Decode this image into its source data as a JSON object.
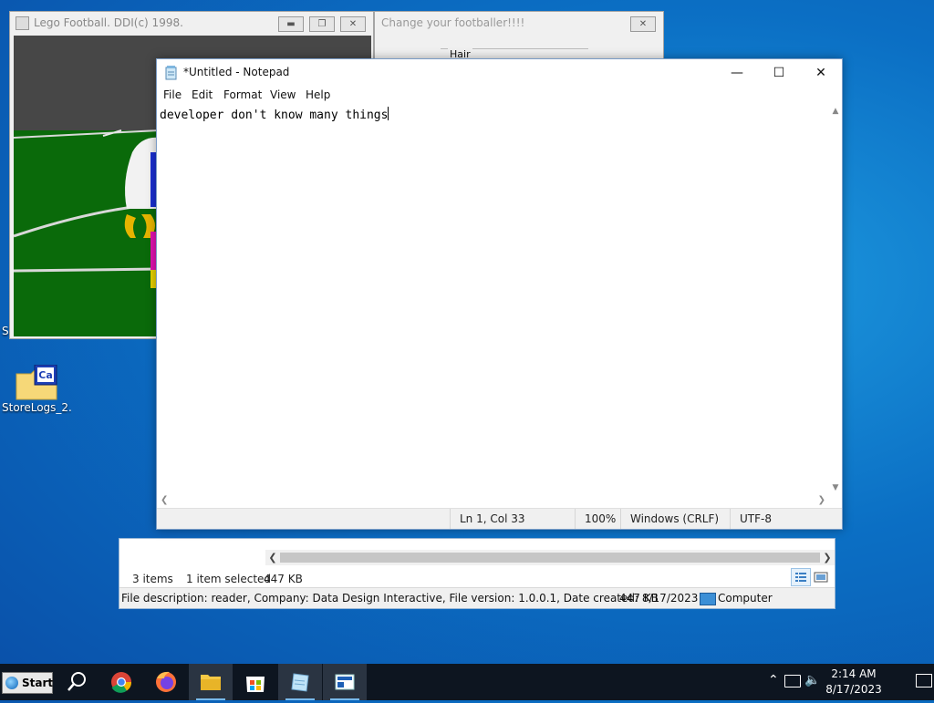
{
  "desktop": {
    "icon_label": "StoreLogs_2...",
    "clipped_label": "S"
  },
  "lego_window": {
    "title": "Lego Football.  DDI(c) 1998."
  },
  "change_window": {
    "title": "Change your footballer!!!!",
    "hair_label": "Hair"
  },
  "explorer": {
    "items_count": "3 items",
    "selected": "1 item selected",
    "selected_size": "447 KB",
    "file_description": "File description: reader, Company: Data Design Interactive, File version: 1.0.0.1, Date created: 8/17/2023",
    "info_size": "447 KB",
    "location": "Computer"
  },
  "notepad": {
    "title": "*Untitled - Notepad",
    "menu": [
      "File",
      "Edit",
      "Format",
      "View",
      "Help"
    ],
    "content": "developer don't know many things",
    "status": {
      "position": "Ln 1, Col 33",
      "zoom": "100%",
      "line_endings": "Windows (CRLF)",
      "encoding": "UTF-8"
    }
  },
  "taskbar": {
    "start_label": "Start",
    "icons": [
      "search-icon",
      "chrome-icon",
      "firefox-icon",
      "file-explorer-icon",
      "store-icon",
      "notepad-icon",
      "reader-app-icon"
    ],
    "clock": {
      "time": "2:14 AM",
      "date": "8/17/2023"
    }
  }
}
